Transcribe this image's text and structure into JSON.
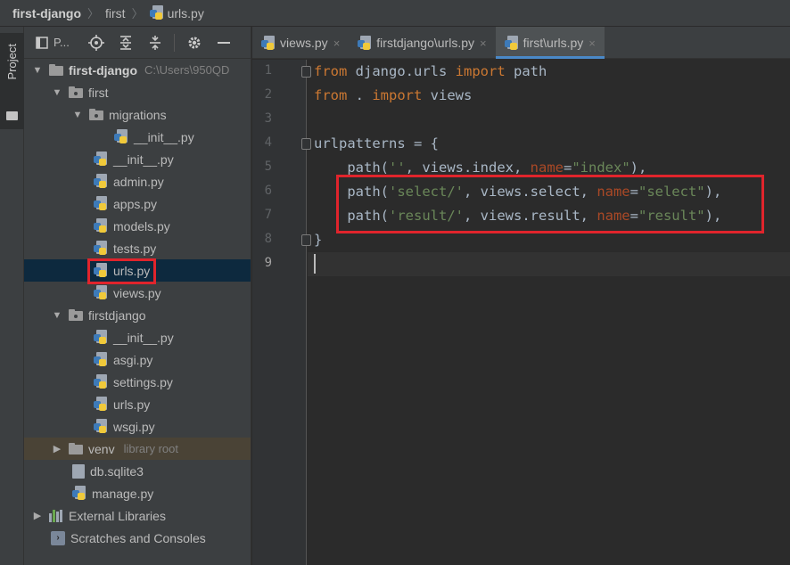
{
  "breadcrumb": {
    "project": "first-django",
    "folder": "first",
    "file": "urls.py"
  },
  "toolstrip": {
    "project_label": "Project"
  },
  "project_panel": {
    "title": "P..."
  },
  "tree": {
    "root_name": "first-django",
    "root_path": "C:\\Users\\950QD",
    "items": [
      {
        "label": "first"
      },
      {
        "label": "migrations"
      },
      {
        "label": "__init__.py"
      },
      {
        "label": "__init__.py"
      },
      {
        "label": "admin.py"
      },
      {
        "label": "apps.py"
      },
      {
        "label": "models.py"
      },
      {
        "label": "tests.py"
      },
      {
        "label": "urls.py"
      },
      {
        "label": "views.py"
      },
      {
        "label": "firstdjango"
      },
      {
        "label": "__init__.py"
      },
      {
        "label": "asgi.py"
      },
      {
        "label": "settings.py"
      },
      {
        "label": "urls.py"
      },
      {
        "label": "wsgi.py"
      },
      {
        "label": "venv"
      },
      {
        "label": "db.sqlite3"
      },
      {
        "label": "manage.py"
      },
      {
        "label": "External Libraries"
      },
      {
        "label": "Scratches and Consoles"
      }
    ],
    "venv_note": "library root"
  },
  "tabs": [
    {
      "label": "views.py"
    },
    {
      "label": "firstdjango\\urls.py"
    },
    {
      "label": "first\\urls.py"
    }
  ],
  "close_glyph": "×",
  "editor": {
    "line_numbers": [
      "1",
      "2",
      "3",
      "4",
      "5",
      "6",
      "7",
      "8",
      "9"
    ],
    "code": {
      "l1": {
        "k1": "from",
        "t1": " django.urls ",
        "k2": "import",
        "t2": " path"
      },
      "l2": {
        "k1": "from",
        "t1": " . ",
        "k2": "import",
        "t2": " views"
      },
      "l4": {
        "t1": "urlpatterns = {"
      },
      "l5": {
        "t1": "    path(",
        "s1": "''",
        "t2": ", views.index, ",
        "p1": "name",
        "t3": "=",
        "s2": "\"index\"",
        "t4": "),"
      },
      "l6": {
        "t1": "    path(",
        "s1": "'select/'",
        "t2": ", views.select, ",
        "p1": "name",
        "t3": "=",
        "s2": "\"select\"",
        "t4": "),"
      },
      "l7": {
        "t1": "    path(",
        "s1": "'result/'",
        "t2": ", views.result, ",
        "p1": "name",
        "t3": "=",
        "s2": "\"result\"",
        "t4": "),"
      },
      "l8": {
        "t1": "}"
      }
    }
  },
  "colors": {
    "keyword": "#cc7832",
    "string": "#6a8759",
    "param": "#aa4926",
    "highlight_box": "#e0242c",
    "selection": "#0d293e"
  }
}
